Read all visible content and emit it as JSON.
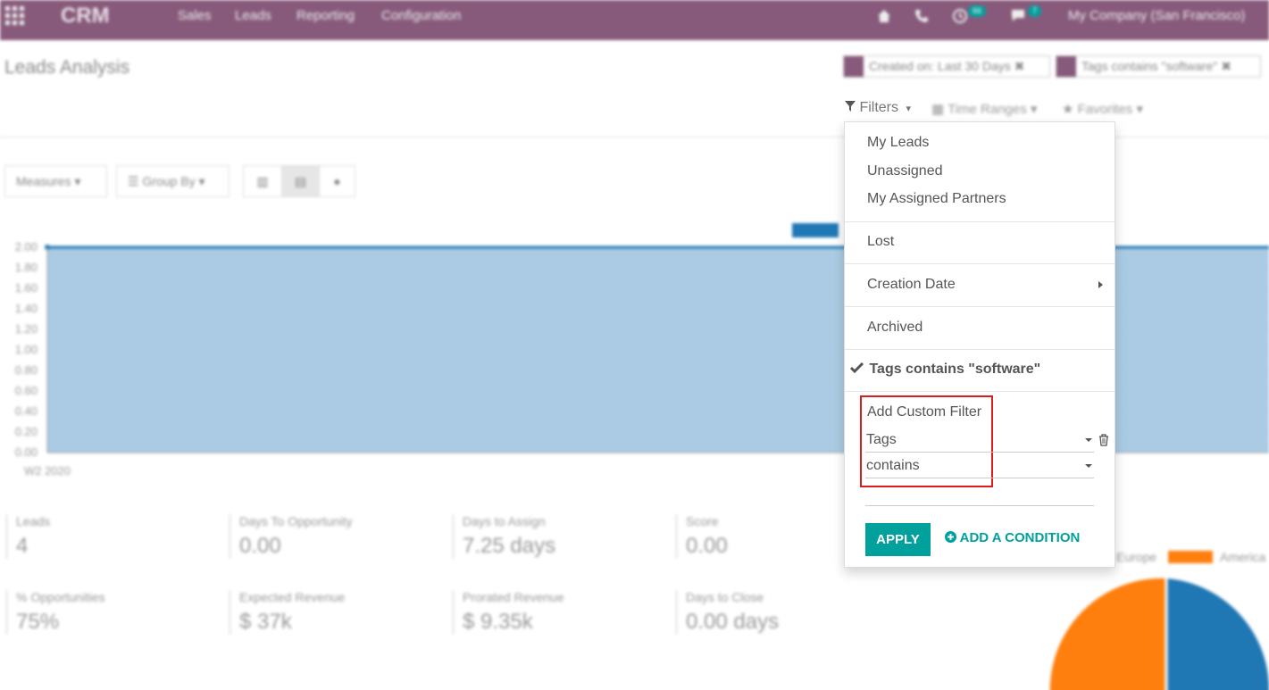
{
  "navbar": {
    "app_name": "CRM",
    "menu": [
      "Sales",
      "Leads",
      "Reporting",
      "Configuration"
    ],
    "activity_count": "66",
    "message_count": "7",
    "company": "My Company (San Francisco)",
    "bg_color": "#875a7b"
  },
  "page": {
    "title": "Leads Analysis",
    "facets": [
      "Created on: Last 30 Days",
      "Tags contains \"software\""
    ]
  },
  "search_options": {
    "filters_label": "Filters",
    "time_ranges_label": "Time Ranges",
    "favorites_label": "Favorites"
  },
  "graph_toolbar": {
    "measures_label": "Measures",
    "group_by_label": "Group By"
  },
  "chart_data": {
    "type": "area",
    "categories": [
      "W2 2020"
    ],
    "y_ticks": [
      "2.00",
      "1.80",
      "1.60",
      "1.40",
      "1.20",
      "1.00",
      "0.80",
      "0.60",
      "0.40",
      "0.20",
      "0.00"
    ],
    "values": [
      2,
      2
    ],
    "ylim": [
      0,
      2
    ],
    "grid": true,
    "fill_color": "#a5c8e1",
    "line_color": "#1f77b4"
  },
  "kpis": [
    {
      "label": "Leads",
      "value": "4"
    },
    {
      "label": "Days To Opportunity",
      "value": "0.00"
    },
    {
      "label": "Days to Assign",
      "value": "7.25 days"
    },
    {
      "label": "Score",
      "value": "0.00"
    },
    {
      "label": "% Opportunities",
      "value": "75%"
    },
    {
      "label": "Expected Revenue",
      "value": "$ 37k"
    },
    {
      "label": "Prorated Revenue",
      "value": "$ 9.35k"
    },
    {
      "label": "Days to Close",
      "value": "0.00 days"
    }
  ],
  "pie_legend": [
    "Europe",
    "America"
  ],
  "filters_menu": {
    "items": [
      "My Leads",
      "Unassigned",
      "My Assigned Partners",
      "Lost",
      "Creation Date",
      "Archived"
    ],
    "active_filter": "Tags contains \"software\"",
    "custom_filter_title": "Add Custom Filter",
    "field_value": "Tags",
    "operator_value": "contains",
    "apply_label": "APPLY",
    "add_condition_label": "ADD A CONDITION",
    "accent_color": "#00a09d",
    "highlight_color": "#dc1c1c"
  }
}
